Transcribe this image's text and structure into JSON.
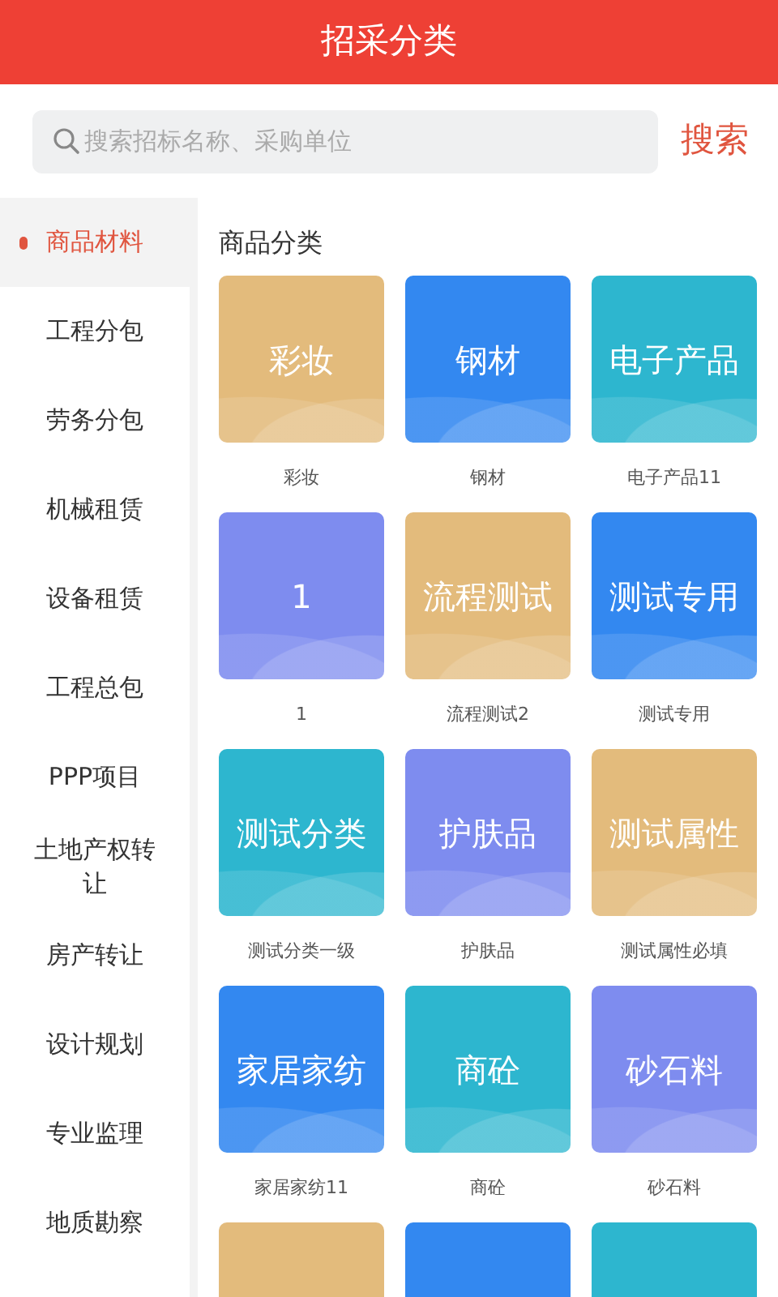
{
  "header": {
    "title": "招采分类"
  },
  "search": {
    "placeholder": "搜索招标名称、采购单位",
    "button": "搜索"
  },
  "sidebar": {
    "items": [
      {
        "label": "商品材料",
        "selected": true
      },
      {
        "label": "工程分包",
        "selected": false
      },
      {
        "label": "劳务分包",
        "selected": false
      },
      {
        "label": "机械租赁",
        "selected": false
      },
      {
        "label": "设备租赁",
        "selected": false
      },
      {
        "label": "工程总包",
        "selected": false
      },
      {
        "label": "PPP项目",
        "selected": false
      },
      {
        "label": "土地产权转让",
        "selected": false
      },
      {
        "label": "房产转让",
        "selected": false
      },
      {
        "label": "设计规划",
        "selected": false
      },
      {
        "label": "专业监理",
        "selected": false
      },
      {
        "label": "地质勘察",
        "selected": false
      }
    ]
  },
  "content": {
    "heading": "商品分类",
    "tiles": [
      {
        "tile_text": "彩妆",
        "caption": "彩妆",
        "color": "#e3bb7c"
      },
      {
        "tile_text": "钢材",
        "caption": "钢材",
        "color": "#3388f0"
      },
      {
        "tile_text": "电子产品",
        "caption": "电子产品11",
        "color": "#2db6cf"
      },
      {
        "tile_text": "1",
        "caption": "1",
        "color": "#7e8cef"
      },
      {
        "tile_text": "流程测试",
        "caption": "流程测试2",
        "color": "#e3bb7c"
      },
      {
        "tile_text": "测试专用",
        "caption": "测试专用",
        "color": "#3388f0"
      },
      {
        "tile_text": "测试分类",
        "caption": "测试分类一级",
        "color": "#2db6cf"
      },
      {
        "tile_text": "护肤品",
        "caption": "护肤品",
        "color": "#7e8cef"
      },
      {
        "tile_text": "测试属性",
        "caption": "测试属性必填",
        "color": "#e3bb7c"
      },
      {
        "tile_text": "家居家纺",
        "caption": "家居家纺11",
        "color": "#3388f0"
      },
      {
        "tile_text": "商砼",
        "caption": "商砼",
        "color": "#2db6cf"
      },
      {
        "tile_text": "砂石料",
        "caption": "砂石料",
        "color": "#7e8cef"
      },
      {
        "color": "#e3bb7c"
      },
      {
        "color": "#3388f0"
      },
      {
        "color": "#2db6cf"
      }
    ]
  }
}
